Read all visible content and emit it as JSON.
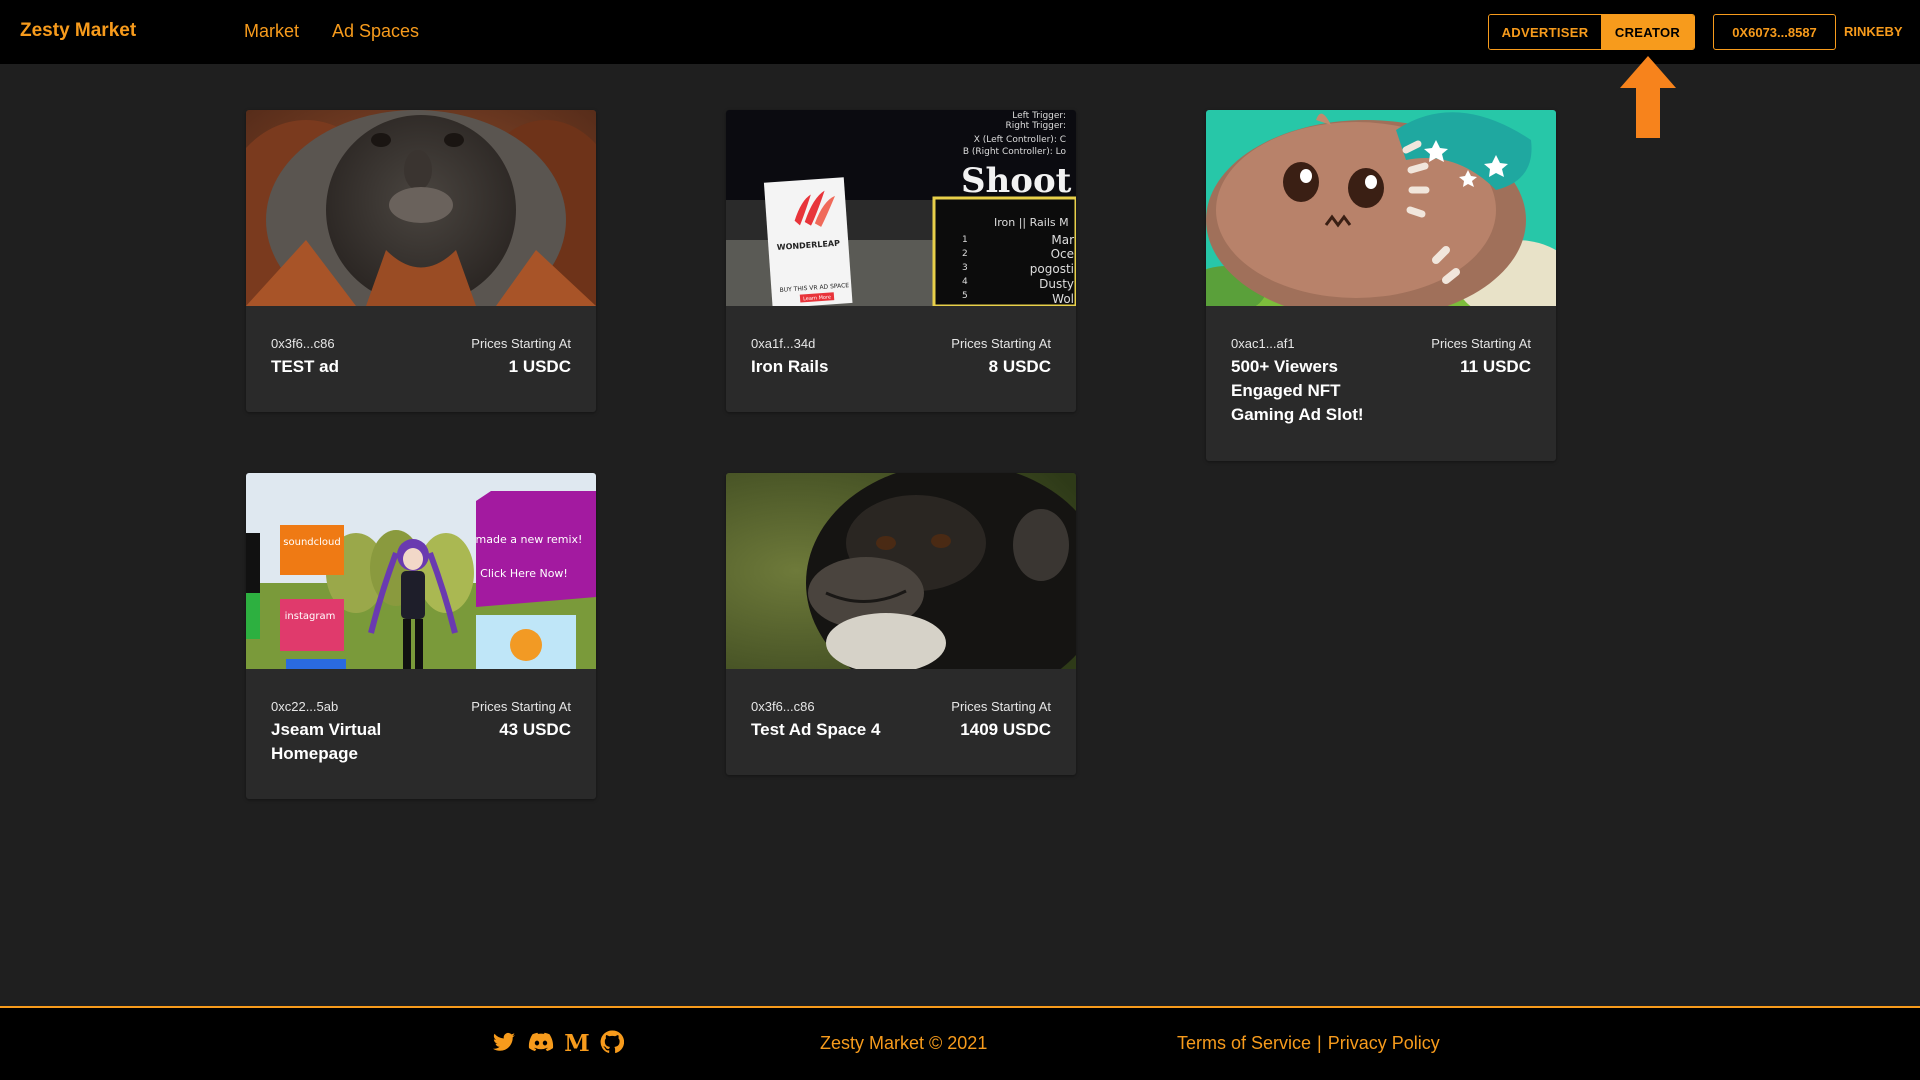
{
  "navbar": {
    "brand": "Zesty Market",
    "links": [
      {
        "label": "Market"
      },
      {
        "label": "Ad Spaces"
      }
    ],
    "roles": {
      "advertiser": "ADVERTISER",
      "creator": "CREATOR",
      "active": "CREATOR"
    },
    "wallet": "0X6073...8587",
    "network": "RINKEBY"
  },
  "cards": [
    {
      "image": "orangutan-photo",
      "address": "0x3f6...c86",
      "prices_label": "Prices Starting At",
      "title": "TEST ad",
      "price": "1 USDC"
    },
    {
      "image": "vr-game-iron-rails-screenshot",
      "address": "0xa1f...34d",
      "prices_label": "Prices Starting At",
      "title": "Iron Rails",
      "price": "8 USDC",
      "image_text": {
        "controls": "Left Trigger:\nRight Trigger:\nX (Left Controller): C\nB (Right Controller): Lo",
        "shoot": "Shoot",
        "board_title": "Iron || Rails M",
        "board_rows": [
          "Mar",
          "Oce",
          "pogosti",
          "Dusty",
          "Wol"
        ],
        "sign_brand": "WONDERLEAP",
        "sign_text": "BUY THIS VR AD SPACE",
        "sign_button": "Learn More"
      }
    },
    {
      "image": "cartoon-monster-art",
      "address": "0xac1...af1",
      "prices_label": "Prices Starting At",
      "title": "500+ Viewers Engaged NFT Gaming Ad Slot!",
      "price": "11 USDC"
    },
    {
      "image": "virtual-homepage-scene",
      "address": "0xc22...5ab",
      "prices_label": "Prices Starting At",
      "title": "Jseam Virtual Homepage",
      "price": "43 USDC",
      "image_text": {
        "soundcloud": "soundcloud",
        "instagram": "instagram",
        "remix": "made a new remix!",
        "click": "Click Here Now!"
      }
    },
    {
      "image": "chimpanzee-photo",
      "address": "0x3f6...c86",
      "prices_label": "Prices Starting At",
      "title": "Test Ad Space 4",
      "price": "1409 USDC"
    }
  ],
  "footer": {
    "social_icons": [
      "twitter-icon",
      "discord-icon",
      "medium-icon",
      "github-icon"
    ],
    "copyright": "Zesty Market © 2021",
    "terms": "Terms of Service",
    "separator": "|",
    "privacy": "Privacy Policy"
  },
  "colors": {
    "accent": "#f79b1c",
    "background": "#1f1f1f",
    "card": "#2a2a2a",
    "navbar": "#000000"
  }
}
